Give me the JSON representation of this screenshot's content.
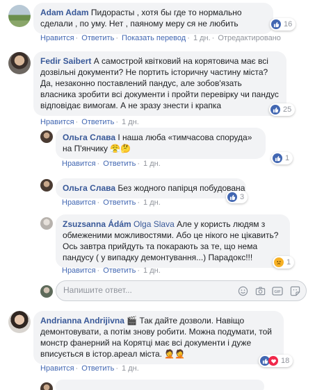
{
  "comments": [
    {
      "author": "Adam Adam",
      "text": "Пидорасты , хотя бы где то нормально сделали , по уму. Нет , паяному меру ся не любить",
      "actions": {
        "like": "Нравится",
        "reply": "Ответить",
        "translate": "Показать перевод",
        "time": "1 дн.",
        "edited": "Отредактировано"
      },
      "reactions": "16"
    },
    {
      "author": "Fedir Saibert",
      "text": "А самострой квітковий на корятовича має всі дозвільні документи? Не портить історичну частину міста? Да, незаконно поставлений пандус, але зобов'язать власника зробити всі документи і пройти перевірку чи пандус відповідає вимогам. А не зразу знести і крапка",
      "actions": {
        "like": "Нравится",
        "reply": "Ответить",
        "time": "1 дн."
      },
      "reactions": "25"
    },
    {
      "author": "Ольга Слава",
      "text": "І наша люба «тимчасова споруда» на П'янчику 😤🤔",
      "actions": {
        "like": "Нравится",
        "reply": "Ответить",
        "time": "1 дн."
      },
      "reactions": "1"
    },
    {
      "author": "Ольга Слава",
      "text": "Без жодного папірця побудована",
      "actions": {
        "like": "Нравится",
        "reply": "Ответить",
        "time": "1 дн."
      },
      "reactions": "3"
    },
    {
      "author": "Zsuzsanna Ádám",
      "mention": "Olga Slava",
      "text": "Але у користь людям з обмеженими можливостями. Або це нікого не цікавить? Ось завтра прийдуть та покарають за те, що нема пандусу ( у випадку демонтування...) Парадокс!!!",
      "actions": {
        "like": "Нравится",
        "reply": "Ответить",
        "time": "1 дн."
      },
      "reactions": "1"
    },
    {
      "author": "Andrianna Andrijivna",
      "text": "🎬 Так дайте дозволи. Навіщо демонтовувати, а потім знову робити. Можна подумати, той монстр фанерний на Корятці має всі документи і дуже вписується в істор.ареал міста. 🤦🤦",
      "actions": {
        "like": "Нравится",
        "reply": "Ответить",
        "time": "1 дн."
      },
      "reactions": "18"
    }
  ],
  "reply_box": {
    "placeholder": "Напишите ответ..."
  },
  "colors": {
    "link": "#385898",
    "bubble": "#f2f3f5",
    "like": "#4267b2",
    "love": "#f0284a",
    "sad": "#f7b125"
  },
  "icons": [
    "emoji-icon",
    "camera-icon",
    "gif-icon",
    "sticker-icon"
  ]
}
